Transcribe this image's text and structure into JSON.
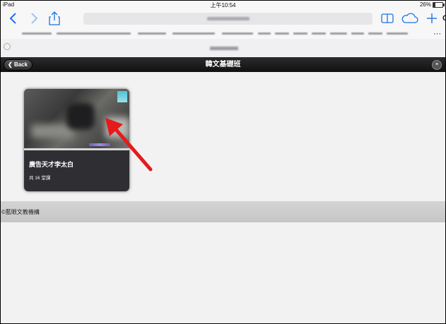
{
  "status_bar": {
    "device": "iPad",
    "time": "上午10:54",
    "battery_percent": "26%"
  },
  "browser": {
    "toolbar": {
      "back_icon": "chevron-left-icon",
      "forward_icon": "chevron-right-icon",
      "share_icon": "share-icon",
      "reload_label": "C",
      "bookmarks_icon": "book-icon",
      "cloud_icon": "cloud-icon",
      "new_tab_icon": "plus-icon"
    },
    "bookmarks_more": "···"
  },
  "app": {
    "nav": {
      "back_label": "Back",
      "title": "韓文基礎班",
      "menu_icon": "list-icon"
    },
    "course_card": {
      "title": "廣告天才李太白",
      "subtitle": "共 16 堂課",
      "progress": 0.0
    },
    "footer_text": "©藍眼文教機構"
  },
  "colors": {
    "accent": "#1a73e8",
    "navbar": "#1a1a1a",
    "card": "#2f2f33",
    "arrow": "#e51b1b"
  }
}
